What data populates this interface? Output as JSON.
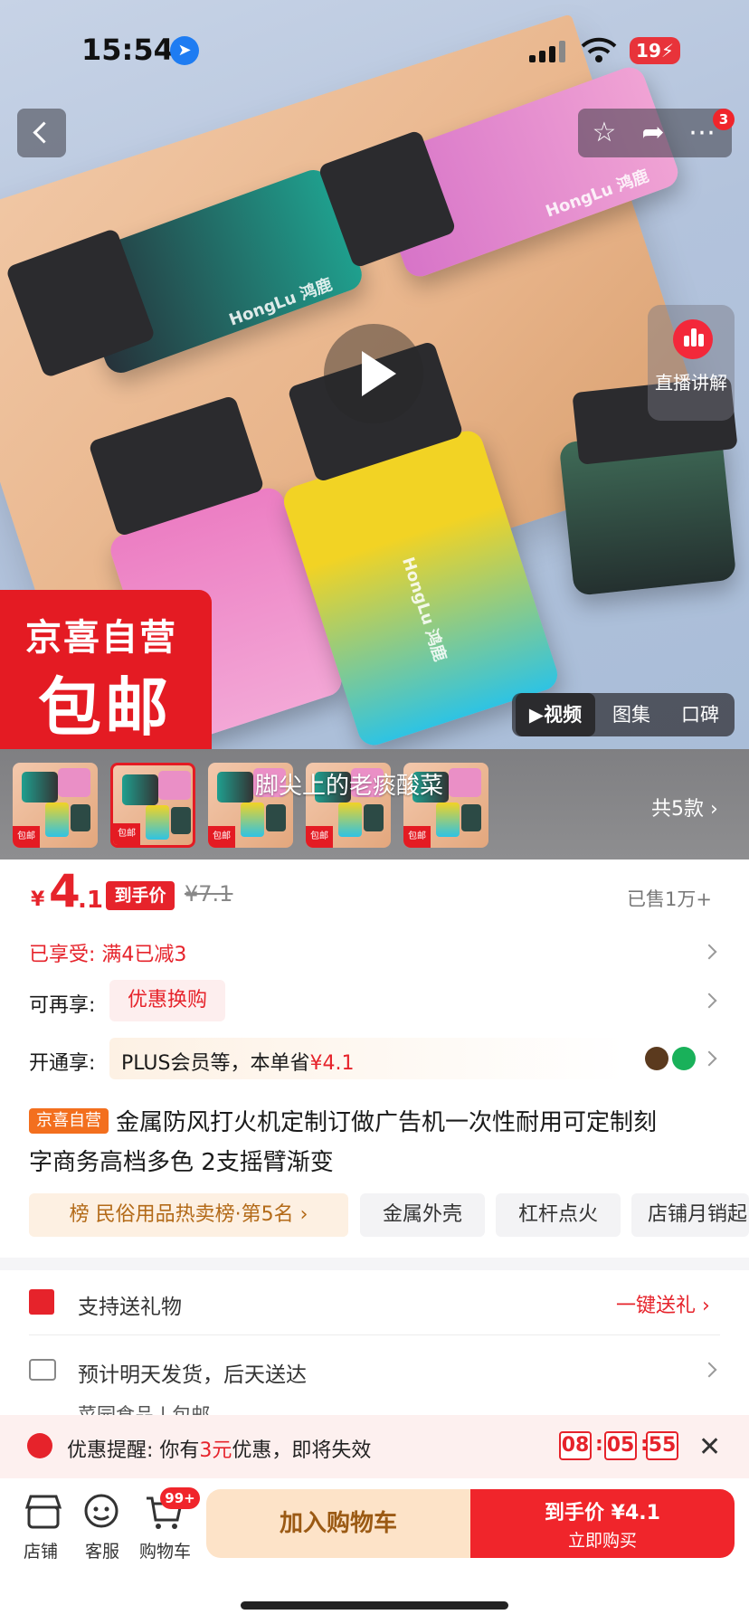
{
  "status": {
    "time": "15:54",
    "battery": "19"
  },
  "hero": {
    "brand": "HongLu 鸿鹿",
    "more_badge": "3",
    "live_label": "直播讲解",
    "promo_line1": "京喜自营",
    "promo_line2": "包邮",
    "media_tabs": [
      "▶视频",
      "图集",
      "口碑"
    ]
  },
  "thumbs": {
    "overlay_text": "脚尖上的老痰酸菜",
    "count": "共5款 ›",
    "thumb_label": "包邮"
  },
  "price": {
    "symbol": "¥",
    "int": "4",
    "dec": ".1",
    "tag": "到手价",
    "original": "¥7.1",
    "sold": "已售1万+"
  },
  "promos": {
    "enjoyed": "已享受: 满4已减3",
    "re_label": "可再享:",
    "re_chip": "优惠换购",
    "open_label": "开通享:",
    "plus_text": "PLUS会员等，本单省",
    "plus_save": "¥4.1"
  },
  "product": {
    "self_tag": "京喜自营",
    "title_line1": "金属防风打火机定制订做广告机一次性耐用可定制刻",
    "title_line2": "字商务高档多色 2支摇臂渐变"
  },
  "chips": [
    "榜 民俗用品热卖榜·第5名 ›",
    "金属外壳",
    "杠杆点火",
    "店铺月销起"
  ],
  "services": {
    "gift_text": "支持送礼物",
    "gift_link": "一键送礼 ›",
    "ship_text": "预计明天发货，后天送达",
    "ship_sub": "菜园食品 | 包邮"
  },
  "reminder": {
    "prefix": "优惠提醒: 你有",
    "amount": "3元",
    "suffix": "优惠，即将失效",
    "h": "08",
    "m": "05",
    "s": "55"
  },
  "bottom": {
    "store": "店铺",
    "service": "客服",
    "cart": "购物车",
    "cart_badge": "99+",
    "add_cart": "加入购物车",
    "buy_l1": "到手价 ¥4.1",
    "buy_l2": "立即购买"
  },
  "colors": {
    "accent": "#e6232b",
    "cart_bg": "#fde3c8",
    "buy_bg": "#f0252b"
  }
}
